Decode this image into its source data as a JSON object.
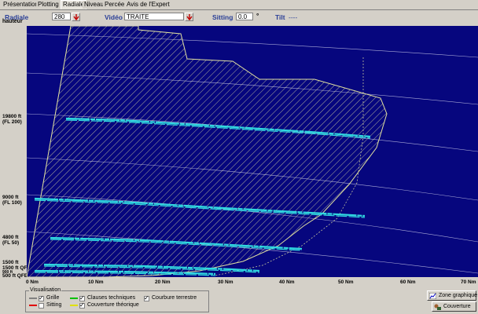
{
  "tabs": [
    {
      "label": "Présentation",
      "active": false
    },
    {
      "label": "Plotting",
      "active": false
    },
    {
      "label": "Radiale",
      "active": true
    },
    {
      "label": "Niveau",
      "active": false
    },
    {
      "label": "Percée",
      "active": false
    },
    {
      "label": "Avis de l'Expert",
      "active": false
    }
  ],
  "toolbar": {
    "radiale_label": "Radiale",
    "radiale_value": "280",
    "video_label": "Vidéo",
    "video_value": "TRAITE",
    "sitting_label": "Sitting",
    "sitting_value": "0.0",
    "sitting_unit": "°",
    "tilt_label": "Tilt",
    "tilt_value": "----"
  },
  "plot": {
    "y_title": "hauteur",
    "y_labels": [
      {
        "text": "19800 ft\n(FL 200)",
        "ft": 19800
      },
      {
        "text": "9000 ft\n(FL 100)",
        "ft": 9000
      },
      {
        "text": "4800 ft\n(FL 50)",
        "ft": 4800
      },
      {
        "text": "1500 ft",
        "ft": 1500
      },
      {
        "text": "1500 ft QFE",
        "ft": 1500
      },
      {
        "text": "900 ft",
        "ft": 900
      },
      {
        "text": "500 ft QFE",
        "ft": 500
      }
    ],
    "x_labels": [
      "0 Nm",
      "10 Nm",
      "20 Nm",
      "30 Nm",
      "40 Nm",
      "50 Nm",
      "60 Nm",
      "70 Nm"
    ],
    "colors": {
      "background": "#06067e",
      "coverage": "#d8d8a0",
      "track": "#30d8e0",
      "grid": "#c8c8e8"
    }
  },
  "visualisation": {
    "title": "Visualisation",
    "options": [
      {
        "label": "Grille",
        "checked": true,
        "color": "#808080"
      },
      {
        "label": "Sitting",
        "checked": false,
        "color": "#e00000"
      },
      {
        "label": "Clauses techniques",
        "checked": true,
        "color": "#00c000"
      },
      {
        "label": "Couverture théorique",
        "checked": true,
        "color": "#e0e000"
      },
      {
        "label": "Courbure terrestre",
        "checked": true,
        "color": ""
      }
    ]
  },
  "buttons": {
    "zone_graphique": "Zone graphique",
    "couverture": "Couverture"
  }
}
